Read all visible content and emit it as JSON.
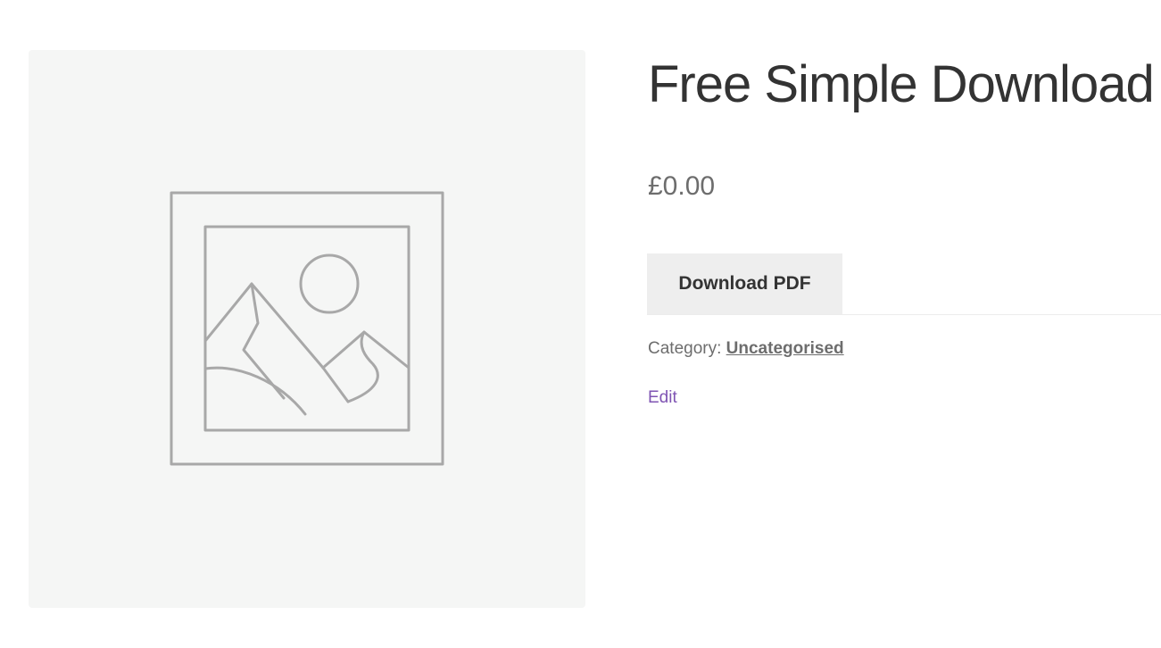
{
  "product": {
    "title": "Free Simple Download",
    "price": "£0.00",
    "button_label": "Download PDF",
    "category_label": "Category:",
    "category_link": "Uncategorised",
    "edit_label": "Edit"
  },
  "image": {
    "icon": "placeholder-image-icon"
  },
  "colors": {
    "accent_link": "#7f54b3",
    "placeholder_bg": "#f5f6f5",
    "placeholder_stroke": "#a8a8a8",
    "button_bg": "#eeeeee"
  }
}
